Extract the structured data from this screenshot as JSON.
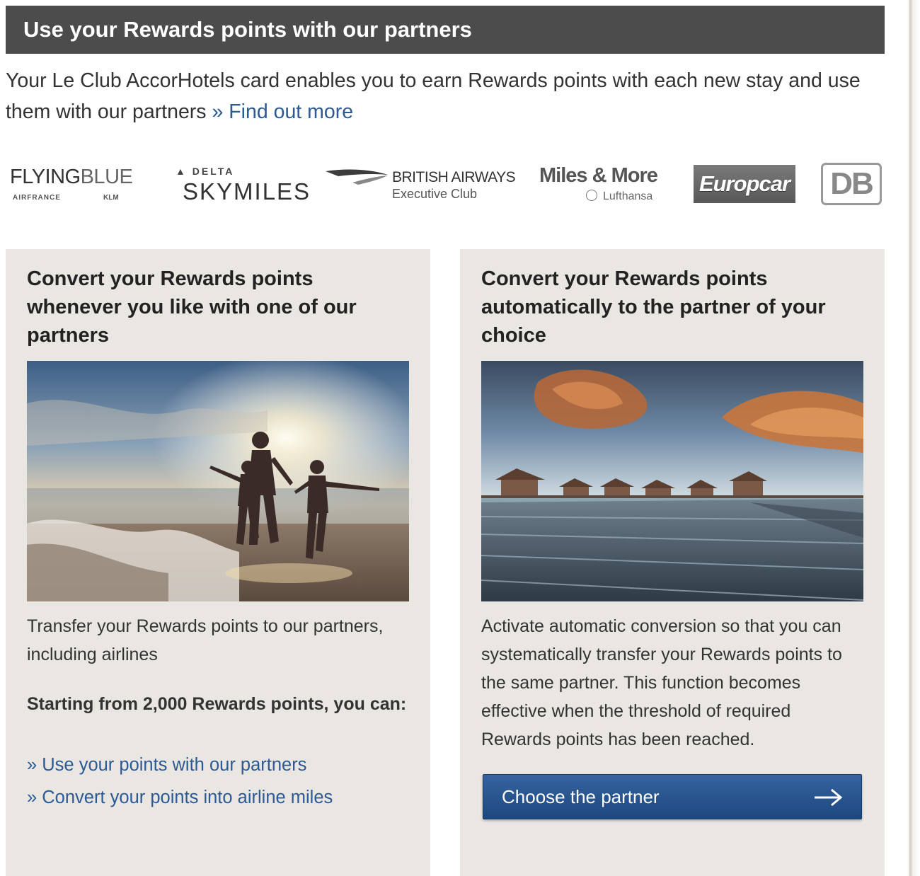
{
  "header": {
    "title": "Use your Rewards points with our partners"
  },
  "intro": {
    "text": "Your Le Club AccorHotels card enables you to earn Rewards points with each new stay and use them with our partners",
    "link_label": "» Find out more"
  },
  "partners": {
    "flying_blue": {
      "main_bold": "FLYING",
      "main_thin": "BLUE",
      "sub_left": "AIRFRANCE",
      "sub_right": "KLM"
    },
    "delta": {
      "top": "DELTA",
      "main": "SKYMILES"
    },
    "british_airways": {
      "main": "BRITISH AIRWAYS",
      "sub": "Executive Club"
    },
    "miles_more": {
      "main": "Miles & More",
      "sub": "Lufthansa"
    },
    "europcar": {
      "main": "Europcar"
    },
    "db": {
      "main": "DB"
    }
  },
  "cards": {
    "manual": {
      "title": "Convert your Rewards points whenever you like with one of our partners",
      "text": "Transfer your Rewards points to our partners, including airlines",
      "subhead": "Starting from 2,000 Rewards points, you can:",
      "links": [
        "» Use your points with our partners",
        "» Convert your points into airline miles"
      ]
    },
    "automatic": {
      "title": "Convert your Rewards points automatically to the partner of your choice",
      "text": "Activate automatic conversion so that you can systematically transfer your Rewards points to the same partner. This function becomes effective when the threshold of required Rewards points has been reached.",
      "button_label": "Choose the partner"
    }
  },
  "colors": {
    "header_bg": "#4b4c4b",
    "card_bg": "#eae6e2",
    "link": "#2b5a95",
    "button": "#285792"
  }
}
